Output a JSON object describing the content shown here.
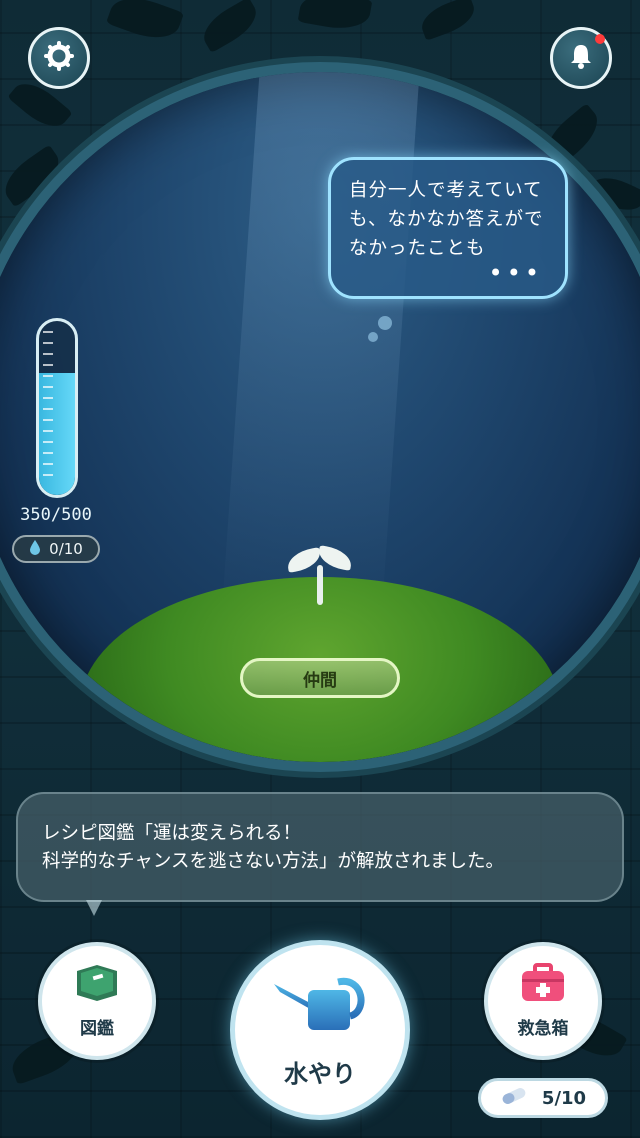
{
  "thought_bubble": {
    "text": "自分一人で考えていても、なかなか答えがでなかったことも",
    "more": "•••"
  },
  "water_gauge": {
    "label": "350/500",
    "current": 350,
    "max": 500,
    "fill_fraction": 0.7
  },
  "drops": {
    "label": "0/10"
  },
  "friends_button": {
    "label": "仲間"
  },
  "message": {
    "line1": "レシピ図鑑「運は変えられる！",
    "line2": "科学的なチャンスを逃さない方法」が解放されました。"
  },
  "buttons": {
    "encyclopedia": {
      "label": "図鑑",
      "icon": "book-icon"
    },
    "water": {
      "label": "水やり",
      "icon": "watering-can-icon"
    },
    "first_aid": {
      "label": "救急箱",
      "icon": "first-aid-kit-icon"
    }
  },
  "pills": {
    "label": "5/10",
    "icon": "capsule-icon"
  },
  "top_icons": {
    "settings": "gear-icon",
    "notifications": "bell-icon",
    "notification_dot": "#ff3b3b"
  },
  "colors": {
    "accent": "#9fe3ff",
    "water": "#4cc6ec",
    "grass": "#3f8a22"
  }
}
